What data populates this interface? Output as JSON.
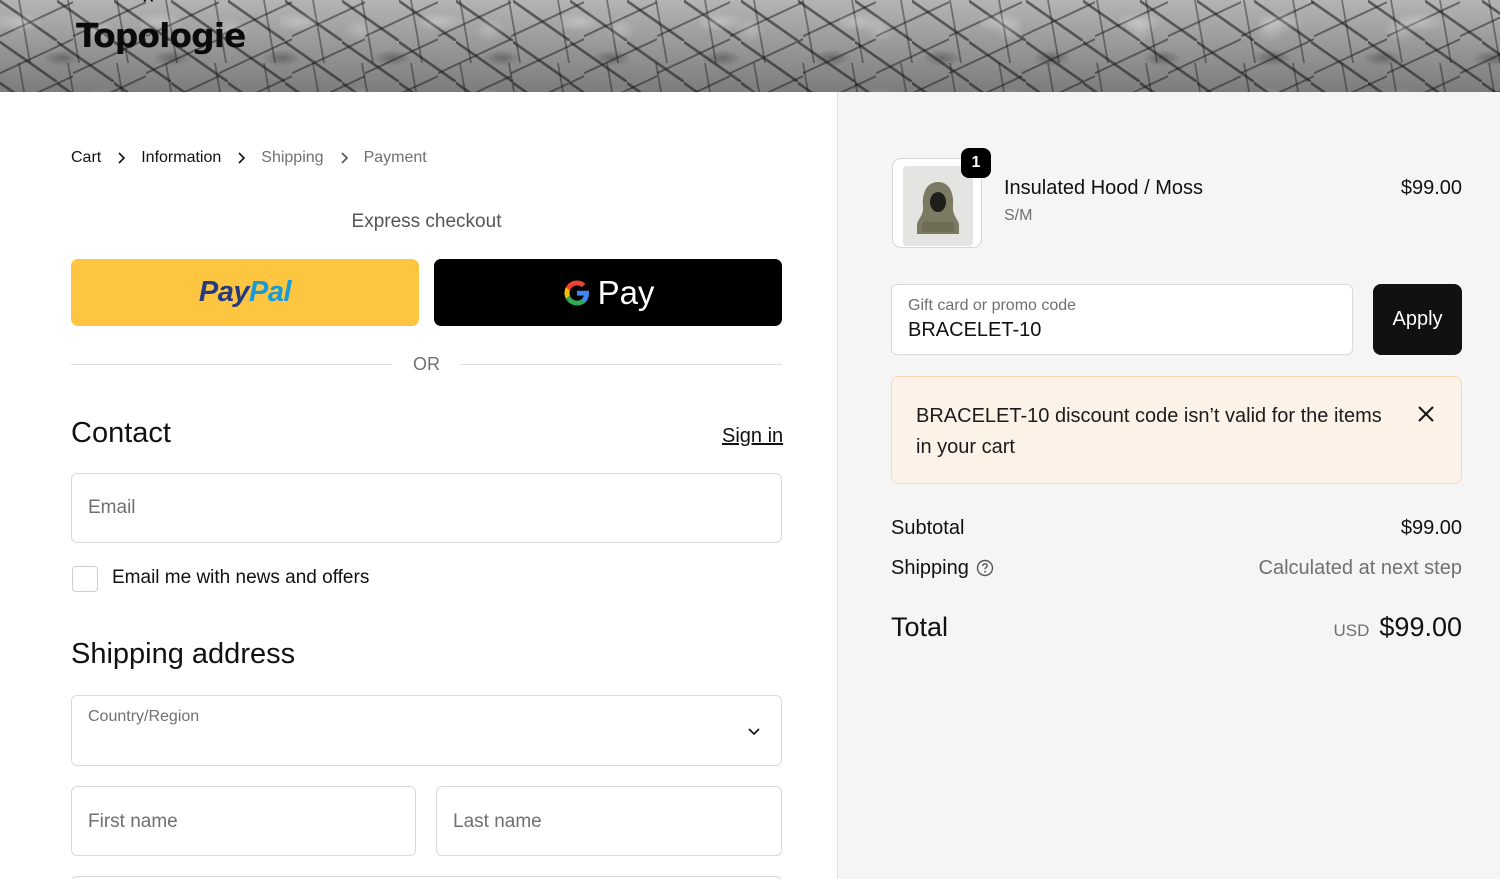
{
  "header": {
    "logo_text": "Topologie",
    "logo_mark": "^"
  },
  "breadcrumb": [
    {
      "label": "Cart",
      "active": true
    },
    {
      "label": "Information",
      "active": true
    },
    {
      "label": "Shipping",
      "active": false
    },
    {
      "label": "Payment",
      "active": false
    }
  ],
  "express": {
    "title": "Express checkout",
    "paypal_part1": "Pay",
    "paypal_part2": "Pal",
    "gpay_label": "Pay",
    "or_label": "OR"
  },
  "contact": {
    "heading": "Contact",
    "sign_in": "Sign in",
    "email_placeholder": "Email",
    "newsletter_label": "Email me with news and offers"
  },
  "shipping_address": {
    "heading": "Shipping address",
    "country_label": "Country/Region",
    "country_value": "",
    "first_name_placeholder": "First name",
    "last_name_placeholder": "Last name"
  },
  "summary": {
    "item": {
      "quantity": "1",
      "name": "Insulated Hood / Moss",
      "variant": "S/M",
      "price": "$99.00"
    },
    "discount": {
      "label": "Gift card or promo code",
      "value": "BRACELET-10",
      "apply_label": "Apply",
      "error": "BRACELET-10 discount code isn’t valid for the items in your cart"
    },
    "subtotal_label": "Subtotal",
    "subtotal_value": "$99.00",
    "shipping_label": "Shipping",
    "shipping_value": "Calculated at next step",
    "total_label": "Total",
    "total_currency": "USD",
    "total_value": "$99.00"
  },
  "colors": {
    "paypal_yellow": "#fec540",
    "paypal_dark_blue": "#253b80",
    "paypal_light_blue": "#179bd7",
    "alert_bg": "#fdf2e7",
    "apply_bg": "#111111"
  }
}
